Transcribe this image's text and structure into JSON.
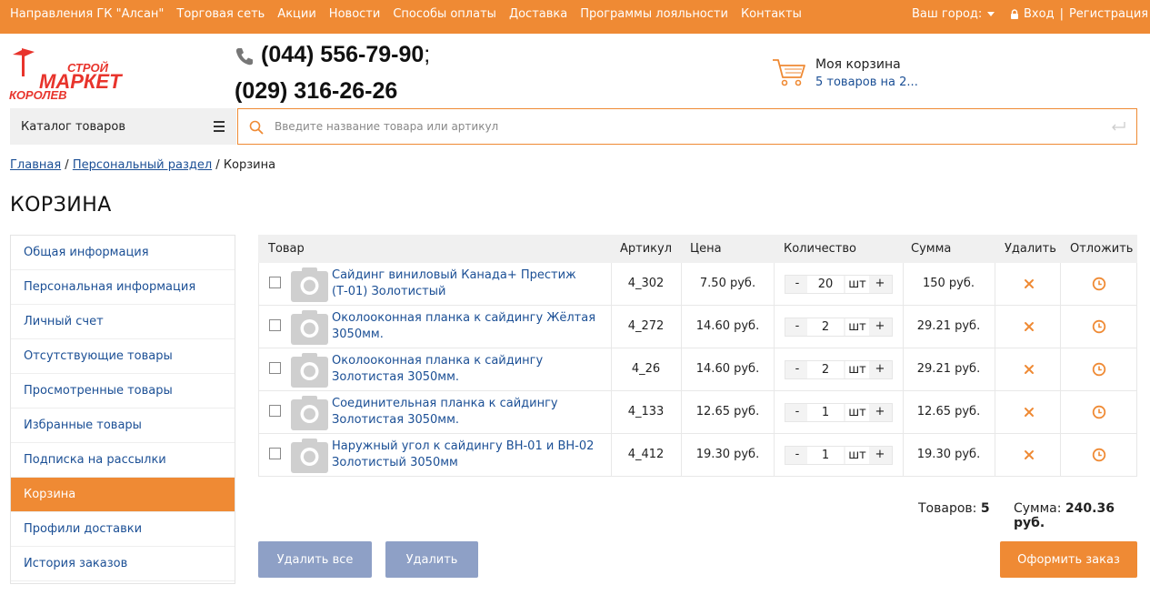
{
  "topbar": {
    "nav": [
      "Направления ГК \"Алсан\"",
      "Торговая сеть",
      "Акции",
      "Новости",
      "Способы оплаты",
      "Доставка",
      "Программы лояльности",
      "Контакты"
    ],
    "city_label": "Ваш город:",
    "login": "Вход",
    "separator": "|",
    "register": "Регистрация"
  },
  "logo": {
    "top": "СТРОЙ",
    "main": "МАРКЕТ",
    "bottom": "КОРОЛЕВ"
  },
  "header": {
    "phone1": "(044) 556-79-90",
    "phone1_sep": ";",
    "phone2": "(029) 316-26-26",
    "cart_title": "Моя корзина",
    "cart_summary": "5 товаров на 2..."
  },
  "catalog": {
    "label": "Каталог товаров"
  },
  "search": {
    "placeholder": "Введите название товара или артикул"
  },
  "breadcrumb": {
    "home": "Главная",
    "sep1": " / ",
    "personal": "Персональный раздел",
    "sep2": " / ",
    "current": "Корзина"
  },
  "page_title": "КОРЗИНА",
  "sidebar": {
    "items": [
      "Общая информация",
      "Персональная информация",
      "Личный счет",
      "Отсутствующие товары",
      "Просмотренные товары",
      "Избранные товары",
      "Подписка на рассылки",
      "Корзина",
      "Профили доставки",
      "История заказов"
    ],
    "active_index": 7
  },
  "table": {
    "headers": {
      "product": "Товар",
      "article": "Артикул",
      "price": "Цена",
      "quantity": "Количество",
      "sum": "Сумма",
      "delete": "Удалить",
      "defer": "Отложить"
    },
    "rows": [
      {
        "name": "Сайдинг виниловый Канада+ Престиж (Т-01) Золотистый",
        "article": "4_302",
        "price": "7.50 руб.",
        "qty": "20",
        "unit": "шт",
        "sum": "150 руб."
      },
      {
        "name": "Околооконная планка к сайдингу Жёлтая 3050мм.",
        "article": "4_272",
        "price": "14.60 руб.",
        "qty": "2",
        "unit": "шт",
        "sum": "29.21 руб."
      },
      {
        "name": "Околооконная планка к сайдингу Золотистая 3050мм.",
        "article": "4_26",
        "price": "14.60 руб.",
        "qty": "2",
        "unit": "шт",
        "sum": "29.21 руб."
      },
      {
        "name": "Соединительная планка к сайдингу Золотистая 3050мм.",
        "article": "4_133",
        "price": "12.65 руб.",
        "qty": "1",
        "unit": "шт",
        "sum": "12.65 руб."
      },
      {
        "name": "Наружный угол к сайдингу ВН-01 и ВН-02 Золотистый 3050мм",
        "article": "4_412",
        "price": "19.30 руб.",
        "qty": "1",
        "unit": "шт",
        "sum": "19.30 руб."
      }
    ],
    "minus": "-",
    "plus": "+"
  },
  "totals": {
    "items_label": "Товаров:",
    "items_value": "5",
    "sum_label": "Сумма:",
    "sum_value": "240.36 руб."
  },
  "buttons": {
    "delete_all": "Удалить все",
    "delete": "Удалить",
    "checkout": "Оформить заказ"
  },
  "colors": {
    "accent": "#ef8a34",
    "link": "#1b4f95",
    "button_grey": "#8ea0c6"
  },
  "icons": [
    "lock-icon",
    "phone-icon",
    "cart-icon",
    "menu-icon",
    "search-icon",
    "enter-icon",
    "photo-placeholder-icon",
    "close-icon",
    "clock-icon"
  ]
}
